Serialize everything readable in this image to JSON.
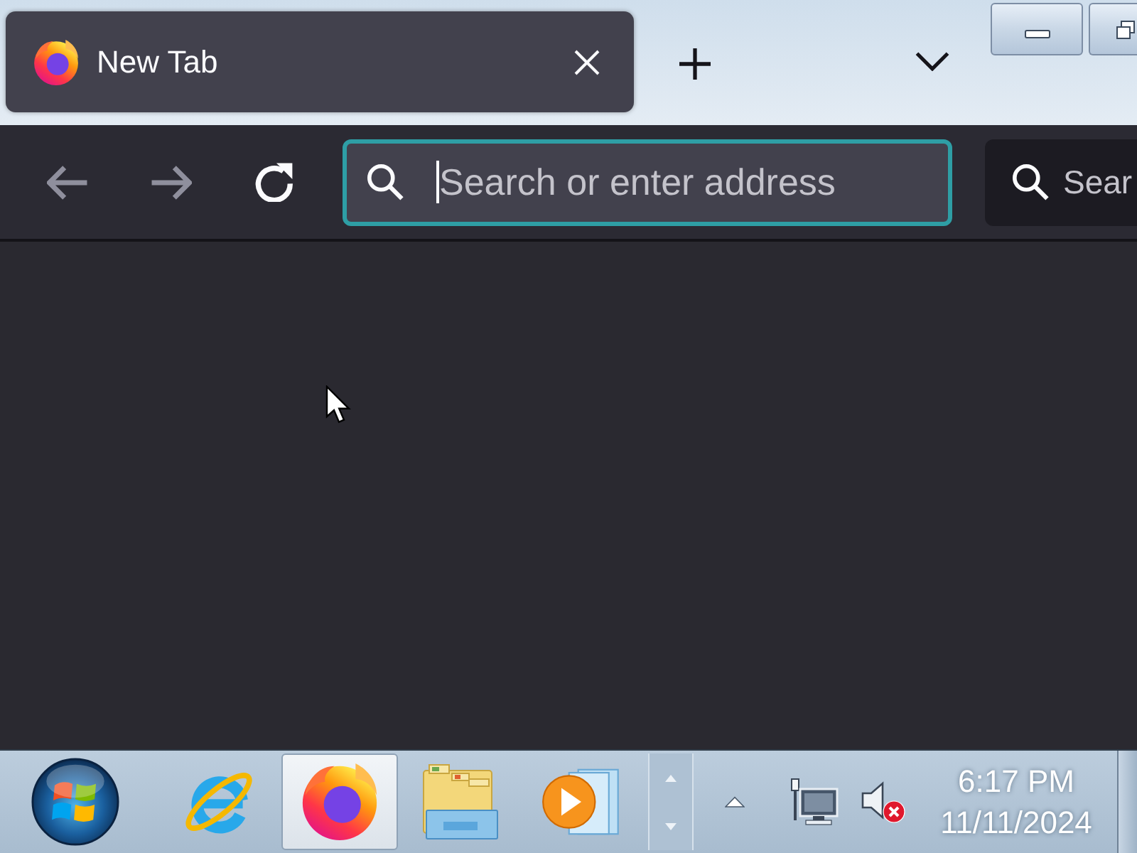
{
  "tabs": [
    {
      "title": "New Tab",
      "selected": true
    }
  ],
  "toolbar": {
    "buttons": [
      {
        "kind": "back",
        "disabled": true
      },
      {
        "kind": "forward",
        "disabled": true
      },
      {
        "kind": "reload",
        "disabled": false
      }
    ],
    "address_bar": {
      "placeholder": "Search or enter address",
      "focused": true
    },
    "search_bar": {
      "placeholder": "Sear"
    }
  },
  "taskbar": {
    "apps": [
      {
        "kind": "internet-explorer",
        "selected": false
      },
      {
        "kind": "firefox",
        "selected": true
      },
      {
        "kind": "file-explorer",
        "selected": false
      },
      {
        "kind": "media-player",
        "selected": false
      }
    ],
    "tray": {
      "volume_muted": true
    },
    "clock": {
      "time": "6:17 PM",
      "date": "11/11/2024"
    }
  }
}
